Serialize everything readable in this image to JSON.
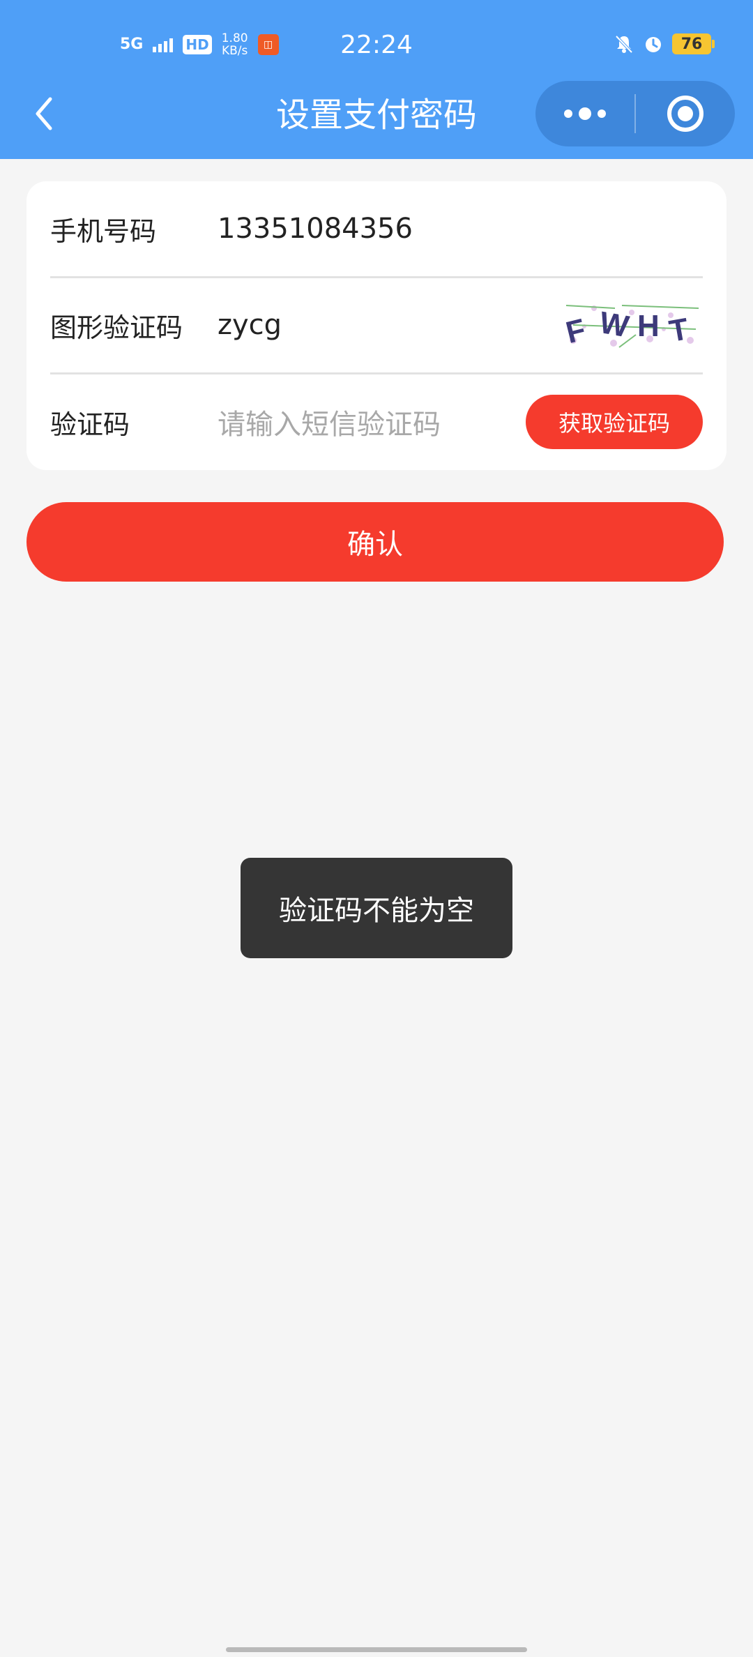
{
  "status_bar": {
    "network": "5G",
    "hd": "HD",
    "speed_value": "1.80",
    "speed_unit": "KB/s",
    "time": "22:24",
    "battery": "76",
    "icons": [
      "signal-icon",
      "hd-icon",
      "app-notification-icon",
      "mute-bell-icon",
      "alarm-icon",
      "battery-icon"
    ]
  },
  "nav": {
    "title": "设置支付密码",
    "back_icon": "chevron-left-icon",
    "more_icon": "more-dots-icon",
    "close_icon": "target-circle-icon"
  },
  "form": {
    "phone": {
      "label": "手机号码",
      "value": "13351084356"
    },
    "image_code": {
      "label": "图形验证码",
      "value": "zycg",
      "captcha_text": "FWHT"
    },
    "sms_code": {
      "label": "验证码",
      "placeholder": "请输入短信验证码",
      "button": "获取验证码"
    }
  },
  "confirm_button": "确认",
  "toast": "验证码不能为空",
  "colors": {
    "header_bg": "#4f9ff7",
    "accent_red": "#f53b2d",
    "page_bg": "#f5f5f5",
    "toast_bg": "#353535"
  }
}
